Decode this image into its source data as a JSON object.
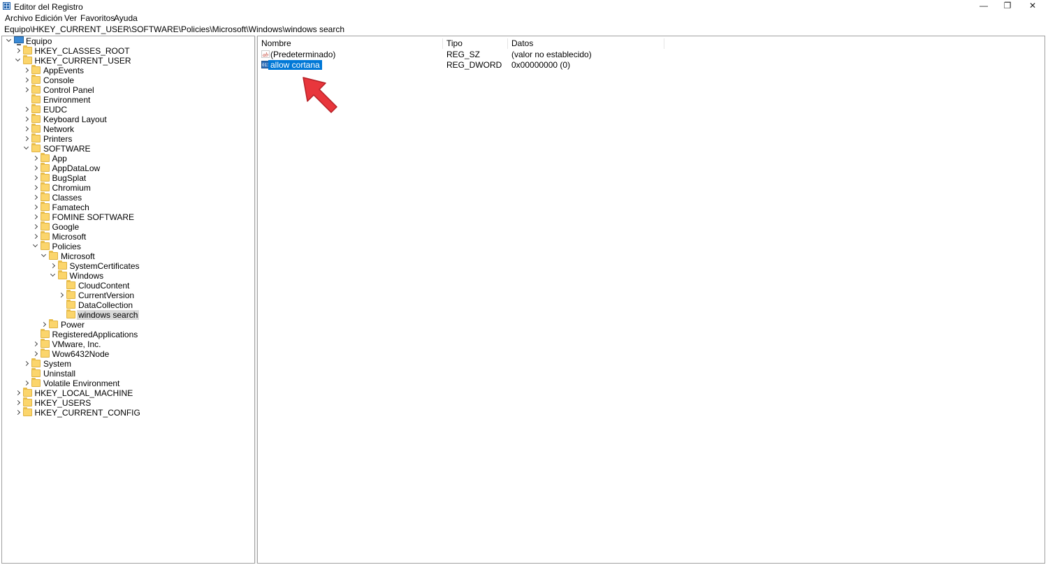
{
  "window": {
    "title": "Editor del Registro",
    "minimize_glyph": "—",
    "restore_glyph": "❐",
    "close_glyph": "✕"
  },
  "menu": [
    "Archivo",
    "Edición",
    "Ver",
    "Favoritos",
    "Ayuda"
  ],
  "address": "Equipo\\HKEY_CURRENT_USER\\SOFTWARE\\Policies\\Microsoft\\Windows\\windows search",
  "tree": [
    {
      "label": "Equipo",
      "level": 0,
      "state": "expanded",
      "icon": "computer-icon"
    },
    {
      "label": "HKEY_CLASSES_ROOT",
      "level": 1,
      "state": "collapsed"
    },
    {
      "label": "HKEY_CURRENT_USER",
      "level": 1,
      "state": "expanded"
    },
    {
      "label": "AppEvents",
      "level": 2,
      "state": "collapsed"
    },
    {
      "label": "Console",
      "level": 2,
      "state": "collapsed"
    },
    {
      "label": "Control Panel",
      "level": 2,
      "state": "collapsed"
    },
    {
      "label": "Environment",
      "level": 2,
      "state": "none"
    },
    {
      "label": "EUDC",
      "level": 2,
      "state": "collapsed"
    },
    {
      "label": "Keyboard Layout",
      "level": 2,
      "state": "collapsed"
    },
    {
      "label": "Network",
      "level": 2,
      "state": "collapsed"
    },
    {
      "label": "Printers",
      "level": 2,
      "state": "collapsed"
    },
    {
      "label": "SOFTWARE",
      "level": 2,
      "state": "expanded"
    },
    {
      "label": "App",
      "level": 3,
      "state": "collapsed"
    },
    {
      "label": "AppDataLow",
      "level": 3,
      "state": "collapsed"
    },
    {
      "label": "BugSplat",
      "level": 3,
      "state": "collapsed"
    },
    {
      "label": "Chromium",
      "level": 3,
      "state": "collapsed"
    },
    {
      "label": "Classes",
      "level": 3,
      "state": "collapsed"
    },
    {
      "label": "Famatech",
      "level": 3,
      "state": "collapsed"
    },
    {
      "label": "FOMINE SOFTWARE",
      "level": 3,
      "state": "collapsed"
    },
    {
      "label": "Google",
      "level": 3,
      "state": "collapsed"
    },
    {
      "label": "Microsoft",
      "level": 3,
      "state": "collapsed"
    },
    {
      "label": "Policies",
      "level": 3,
      "state": "expanded"
    },
    {
      "label": "Microsoft",
      "level": 4,
      "state": "expanded"
    },
    {
      "label": "SystemCertificates",
      "level": 5,
      "state": "collapsed"
    },
    {
      "label": "Windows",
      "level": 5,
      "state": "expanded"
    },
    {
      "label": "CloudContent",
      "level": 6,
      "state": "none"
    },
    {
      "label": "CurrentVersion",
      "level": 6,
      "state": "collapsed"
    },
    {
      "label": "DataCollection",
      "level": 6,
      "state": "none"
    },
    {
      "label": "windows search",
      "level": 6,
      "state": "none",
      "selected": true
    },
    {
      "label": "Power",
      "level": 4,
      "state": "collapsed"
    },
    {
      "label": "RegisteredApplications",
      "level": 3,
      "state": "none"
    },
    {
      "label": "VMware, Inc.",
      "level": 3,
      "state": "collapsed"
    },
    {
      "label": "Wow6432Node",
      "level": 3,
      "state": "collapsed"
    },
    {
      "label": "System",
      "level": 2,
      "state": "collapsed"
    },
    {
      "label": "Uninstall",
      "level": 2,
      "state": "none"
    },
    {
      "label": "Volatile Environment",
      "level": 2,
      "state": "collapsed"
    },
    {
      "label": "HKEY_LOCAL_MACHINE",
      "level": 1,
      "state": "collapsed"
    },
    {
      "label": "HKEY_USERS",
      "level": 1,
      "state": "collapsed"
    },
    {
      "label": "HKEY_CURRENT_CONFIG",
      "level": 1,
      "state": "collapsed"
    }
  ],
  "list": {
    "columns": {
      "name": "Nombre",
      "type": "Tipo",
      "data": "Datos"
    },
    "rows": [
      {
        "name": "(Predeterminado)",
        "type": "REG_SZ",
        "data": "(valor no establecido)",
        "icon": "string-value-icon",
        "icon_glyph": "ab"
      },
      {
        "name": "allow cortana",
        "type": "REG_DWORD",
        "data": "0x00000000 (0)",
        "icon": "dword-value-icon",
        "icon_glyph": "011",
        "selected": true
      }
    ]
  },
  "colors": {
    "selection": "#0078d7",
    "annotation_arrow": "#e8363c"
  }
}
